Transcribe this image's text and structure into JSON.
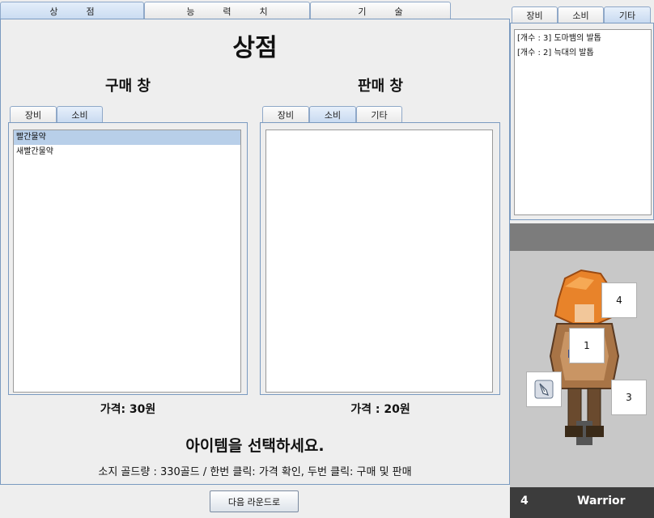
{
  "top_tabs": [
    "상          점",
    "능          력          치",
    "기          술"
  ],
  "shop": {
    "title": "상점",
    "buy_title": "구매 창",
    "sell_title": "판매 창",
    "buy_tabs": [
      "장비",
      "소비"
    ],
    "sell_tabs": [
      "장비",
      "소비",
      "기타"
    ],
    "buy_items": [
      "빨간물약",
      "새빨간물약"
    ],
    "buy_price": "가격:  30원",
    "sell_price": "가격 : 20원",
    "message": "아이템을 선택하세요.",
    "footer": "소지 골드량 : 330골드 /  한번 클릭: 가격 확인, 두번 클릭: 구매 및 판매"
  },
  "next_round_button": "다음 라운드로",
  "inventory": {
    "tabs": [
      "장비",
      "소비",
      "기타"
    ],
    "items": [
      "[개수 : 3] 도마뱀의 발톱",
      "[개수 : 2] 늑대의 발톱"
    ]
  },
  "character": {
    "slots": [
      "4",
      "1",
      "3"
    ],
    "level": "4",
    "class": "Warrior"
  },
  "colors": {
    "accent": "#c9dbf1",
    "border": "#7a9ac0",
    "status_bar": "#3c3c3c"
  }
}
